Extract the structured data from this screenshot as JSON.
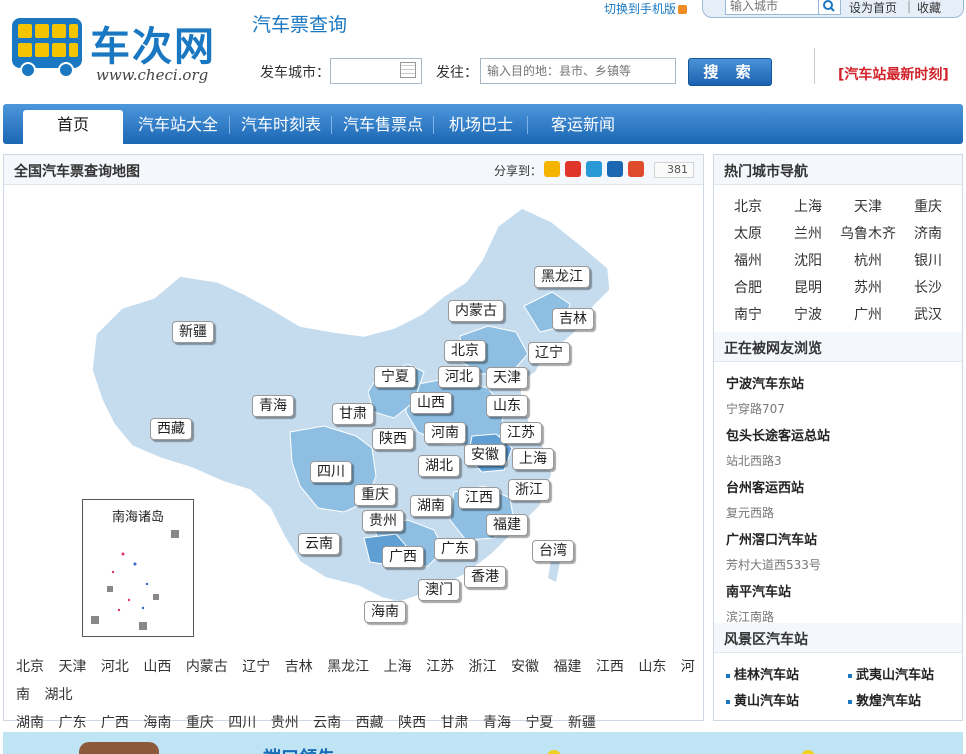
{
  "header": {
    "logo_text": "车次网",
    "logo_url": "www.checi.org",
    "subtitle": "汽车票查询",
    "mobile_link": "切换到手机版",
    "city_search_placeholder": "输入城市",
    "set_home": "设为首页",
    "separator": "|",
    "favorite": "收藏",
    "depart_label": "发车城市：",
    "dest_label": "发往：",
    "dest_placeholder": "输入目的地：县市、乡镇等",
    "search_button": "搜 索",
    "red_link": "[汽车站最新时刻]"
  },
  "nav": {
    "items": [
      "首页",
      "汽车站大全",
      "汽车时刻表",
      "汽车售票点",
      "机场巴士",
      "客运新闻"
    ]
  },
  "map_panel": {
    "title": "全国汽车票查询地图",
    "share_label": "分享到：",
    "share_count": "381",
    "inset_title": "南海诸岛",
    "province_labels": [
      "黑龙江",
      "内蒙古",
      "吉林",
      "新疆",
      "北京",
      "辽宁",
      "宁夏",
      "河北",
      "天津",
      "山西",
      "山东",
      "青海",
      "甘肃",
      "西藏",
      "河南",
      "江苏",
      "陕西",
      "四川",
      "安徽",
      "上海",
      "湖北",
      "浙江",
      "重庆",
      "江西",
      "湖南",
      "贵州",
      "福建",
      "云南",
      "广西",
      "广东",
      "台湾",
      "香港",
      "澳门",
      "海南"
    ],
    "province_list": [
      "北京",
      "天津",
      "河北",
      "山西",
      "内蒙古",
      "辽宁",
      "吉林",
      "黑龙江",
      "上海",
      "江苏",
      "浙江",
      "安徽",
      "福建",
      "江西",
      "山东",
      "河南",
      "湖北",
      "湖南",
      "广东",
      "广西",
      "海南",
      "重庆",
      "四川",
      "贵州",
      "云南",
      "西藏",
      "陕西",
      "甘肃",
      "青海",
      "宁夏",
      "新疆"
    ]
  },
  "side": {
    "hot_title": "热门城市导航",
    "hot_cities": [
      "北京",
      "上海",
      "天津",
      "重庆",
      "太原",
      "兰州",
      "乌鲁木齐",
      "济南",
      "福州",
      "沈阳",
      "杭州",
      "银川",
      "合肥",
      "昆明",
      "苏州",
      "长沙",
      "南宁",
      "宁波",
      "广州",
      "武汉"
    ],
    "browse_title": "正在被网友浏览",
    "browse": [
      {
        "name": "宁波汽车东站",
        "addr": "宁穿路707"
      },
      {
        "name": "包头长途客运总站",
        "addr": "站北西路3"
      },
      {
        "name": "台州客运西站",
        "addr": "复元西路"
      },
      {
        "name": "广州滘口汽车站",
        "addr": "芳村大道西533号"
      },
      {
        "name": "南平汽车站",
        "addr": "滨江南路"
      }
    ],
    "scenic_title": "风景区汽车站",
    "scenic": [
      "桂林汽车站",
      "武夷山汽车站",
      "黄山汽车站",
      "敦煌汽车站"
    ]
  },
  "banner": {
    "text": "端口领先"
  },
  "colors": {
    "brand_blue": "#1a78c2",
    "nav_blue": "#1c67b4",
    "red": "#d0232a",
    "map_light": "#c5dcef",
    "map_mid": "#8ebfe3",
    "map_dark": "#5f9fd4"
  }
}
